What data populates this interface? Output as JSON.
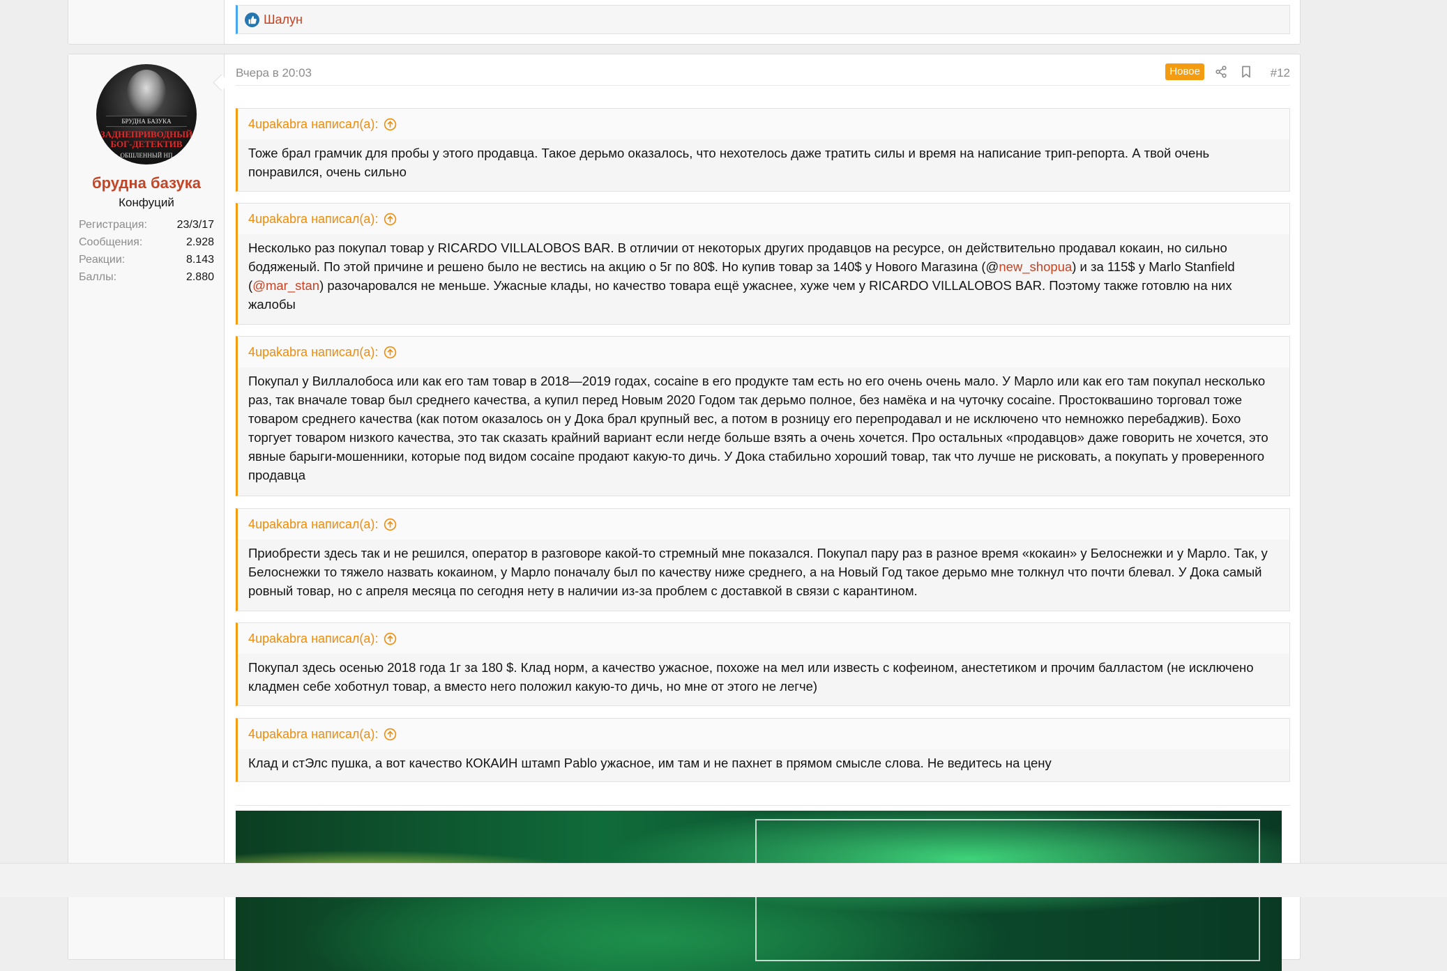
{
  "previous_post": {
    "reaction_user": "Шалун"
  },
  "post": {
    "user": {
      "avatar_text_top": "БРУДНА БАЗУКА",
      "avatar_text_red1": "ЗАДНЕПРИВОДНЫЙ",
      "avatar_text_red2": "БОГ-ДЕТЕКТИВ",
      "avatar_text_bottom": "ОБШЛЕННЫЙ НП",
      "name": "брудна базука",
      "title": "Конфуций",
      "stats": [
        {
          "label": "Регистрация:",
          "value": "23/3/17"
        },
        {
          "label": "Сообщения:",
          "value": "2.928"
        },
        {
          "label": "Реакции:",
          "value": "8.143"
        },
        {
          "label": "Баллы:",
          "value": "2.880"
        }
      ]
    },
    "date": "Вчера в 20:03",
    "badge": "Новое",
    "number": "#12",
    "quotes": [
      {
        "author": "4upakabra написал(а):",
        "text": "Тоже брал грамчик для пробы у этого продавца. Такое дерьмо оказалось, что нехотелось даже тратить силы и время на написание трип-репорта. А твой очень понравился, очень сильно"
      },
      {
        "author": "4upakabra написал(а):",
        "text_a": "Несколько раз покупал товар у RICARDO VILLALOBOS BAR. В отличии от некоторых других продавцов на ресурсе, он действительно продавал кокаин, но сильно бодяженый. По этой причине и решено было не вестись на акцию о 5г по 80$. Но купив товар за 140$ у Нового Магазина (@",
        "mention_1": "new_shopua",
        "text_b": ") и за 115$ у Marlo Stanfield (",
        "mention_2": "@mar_stan",
        "text_c": ") разочаровался не меньше. Ужасные клады, но качество товара ещё ужаснее, хуже чем у RICARDO VILLALOBOS BAR. Поэтому также готовлю на них жалобы"
      },
      {
        "author": "4upakabra написал(а):",
        "text": "Покупал у Виллалобоса или как его там товар в 2018—2019 годах, cocaine в его продукте там есть но его очень очень мало. У Марло или как его там покупал несколько раз, так вначале товар был среднего качества, а купил перед Новым 2020 Годом так дерьмо полное, без намёка и на чуточку cocaine. Простоквашино торговал тоже товаром среднего качества (как потом оказалось он у Дока брал крупный вес, а потом в розницу его перепродавал и не исключено что немножко перебаджив). Бохо торгует товаром низкого качества, это так сказать крайний вариант если негде больше взять а очень хочется. Про остальных «продавцов» даже говорить не хочется, это явные барыги-мошенники, которые под видом cocaine продают какую-то дичь. У Дока стабильно хороший товар, так что лучше не рисковать, а покупать у проверенного продавца"
      },
      {
        "author": "4upakabra написал(а):",
        "text": "Приобрести здесь так и не решился, оператор в разговоре какой-то стремный мне показался. Покупал пару раз в разное время «кокаин» у Белоснежки и у Марло. Так, у Белоснежки то тяжело назвать кокаином, у Марло поначалу был по качеству ниже среднего, а на Новый Год такое дерьмо мне толкнул что почти блевал. У Дока самый ровный товар, но с апреля месяца по сегодня нету в наличии из-за проблем с доставкой в связи с карантином."
      },
      {
        "author": "4upakabra написал(а):",
        "text": "Покупал здесь осенью 2018 года 1г за 180 $. Клад норм, а качество ужасное, похоже на мел или известь с кофеином, анестетиком и прочим балластом (не исключено кладмен себе хоботнул товар, а вместо него положил какую-то дичь, но мне от этого не легче)"
      },
      {
        "author": "4upakabra написал(а):",
        "text": "Клад и стЭлс пушка, а вот качество КОКАИН штамп Pablo ужасное, им там и не пахнет в прямом смысле слова. Не ведитесь на цену"
      }
    ]
  },
  "colors": {
    "accent_orange": "#f39c12",
    "username_red": "#c44426",
    "like_blue": "#2577b1"
  }
}
